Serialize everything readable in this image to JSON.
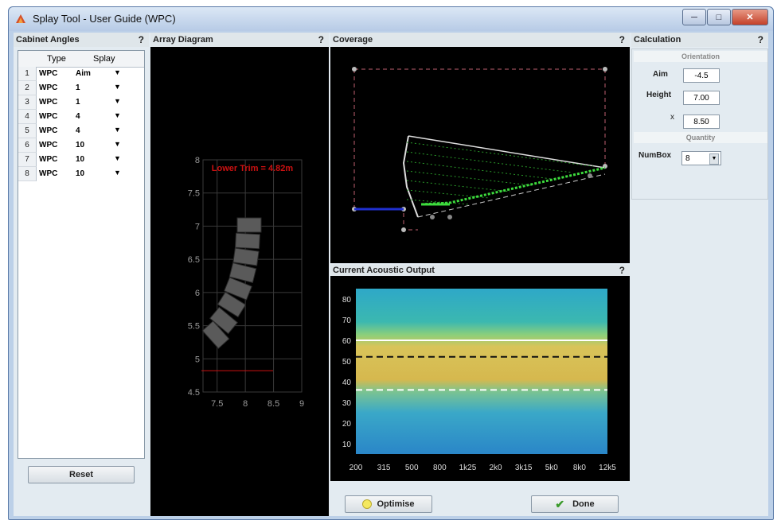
{
  "window": {
    "title": "Splay Tool - User Guide (WPC)"
  },
  "cabinet": {
    "heading": "Cabinet Angles",
    "help": "?",
    "col_type": "Type",
    "col_splay": "Splay",
    "rows": [
      {
        "idx": "1",
        "type": "WPC",
        "splay": "Aim"
      },
      {
        "idx": "2",
        "type": "WPC",
        "splay": "1"
      },
      {
        "idx": "3",
        "type": "WPC",
        "splay": "1"
      },
      {
        "idx": "4",
        "type": "WPC",
        "splay": "4"
      },
      {
        "idx": "5",
        "type": "WPC",
        "splay": "4"
      },
      {
        "idx": "6",
        "type": "WPC",
        "splay": "10"
      },
      {
        "idx": "7",
        "type": "WPC",
        "splay": "10"
      },
      {
        "idx": "8",
        "type": "WPC",
        "splay": "10"
      }
    ],
    "reset_label": "Reset"
  },
  "array": {
    "heading": "Array Diagram",
    "help": "?",
    "annotation": "Lower Trim = 4.82m",
    "x_ticks": [
      "7.5",
      "8",
      "8.5",
      "9"
    ],
    "y_ticks": [
      "8",
      "7.5",
      "7",
      "6.5",
      "6",
      "5.5",
      "5",
      "4.5"
    ],
    "trim_value": 4.82
  },
  "coverage": {
    "heading": "Coverage",
    "help": "?"
  },
  "acoustic": {
    "heading": "Current Acoustic Output",
    "help": "?",
    "y_ticks": [
      "80",
      "70",
      "60",
      "50",
      "40",
      "30",
      "20",
      "10"
    ],
    "x_ticks": [
      "200",
      "315",
      "500",
      "800",
      "1k25",
      "2k0",
      "3k15",
      "5k0",
      "8k0",
      "12k5"
    ]
  },
  "calc": {
    "heading": "Calculation",
    "help": "?",
    "orientation_label": "Orientation",
    "aim_label": "Aim",
    "aim_value": "-4.5",
    "height_label": "Height",
    "height_value": "7.00",
    "x_label": "x",
    "x_value": "8.50",
    "quantity_label": "Quantity",
    "numbox_label": "NumBox",
    "numbox_value": "8"
  },
  "buttons": {
    "optimise": "Optimise",
    "done": "Done"
  },
  "colors": {
    "grid": "#3a3a3a",
    "trim": "#cc1111",
    "speaker": "#5a5a5a",
    "coverage_box": "#c06070",
    "rays": "#3ddc3d",
    "floor": "#2030d0"
  }
}
